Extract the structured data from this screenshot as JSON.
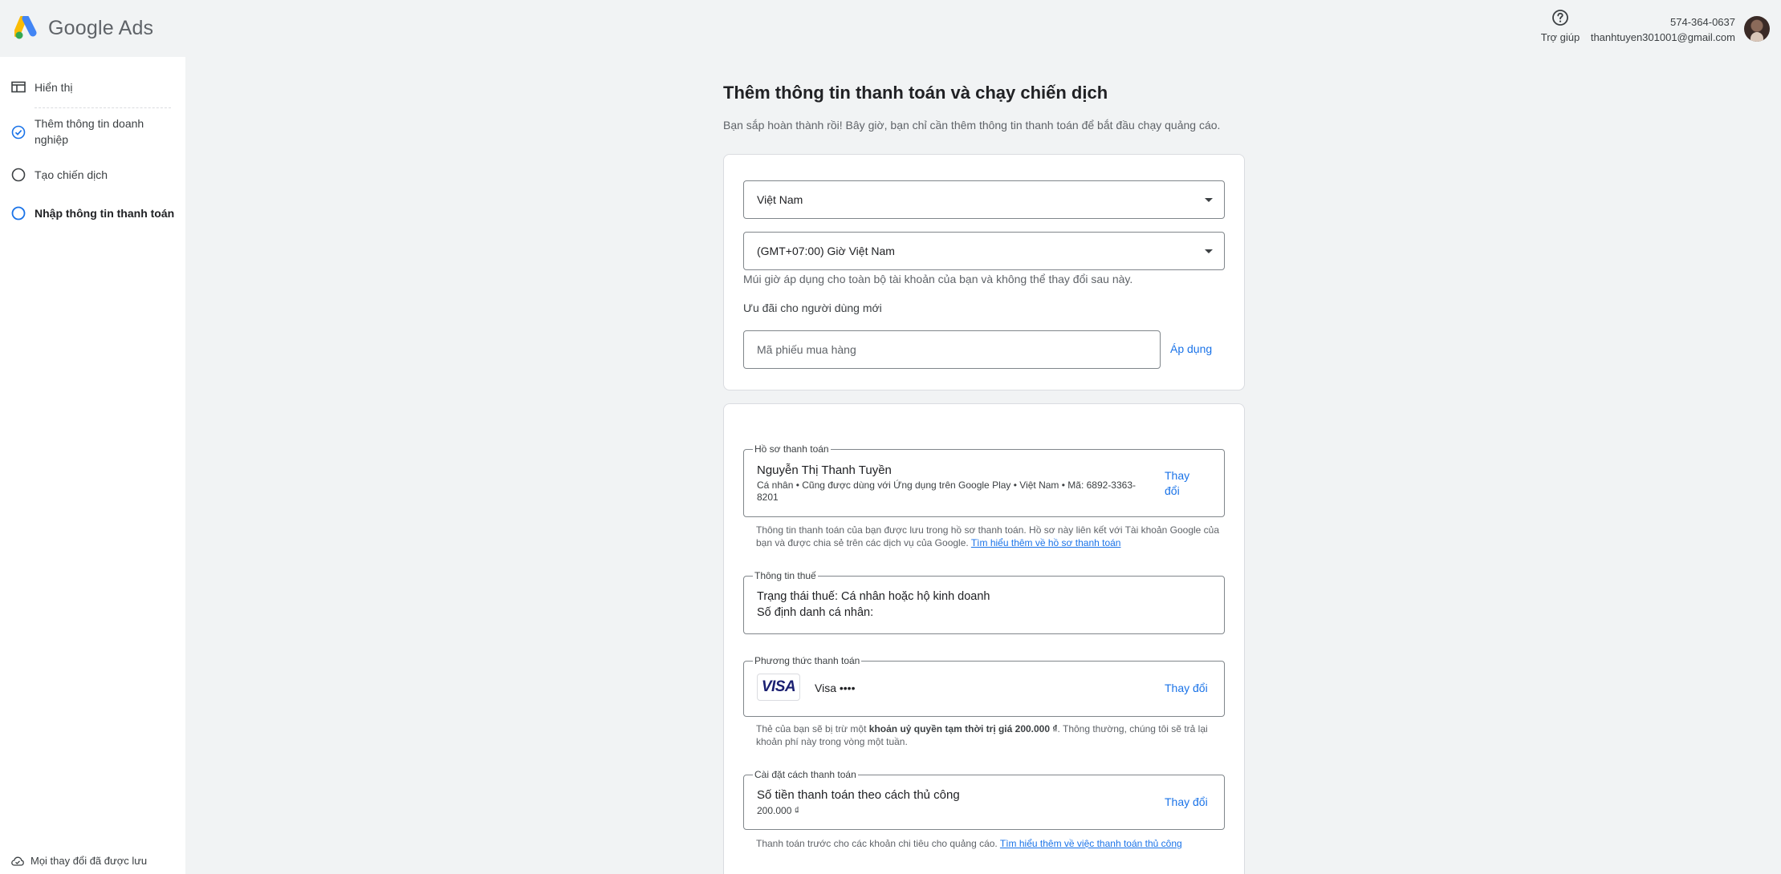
{
  "header": {
    "brand": "Google Ads",
    "help_label": "Trợ giúp",
    "account_phone": "574-364-0637",
    "account_email": "thanhtuyen301001@gmail.com"
  },
  "sidebar": {
    "items": [
      {
        "label": "Hiển thị",
        "icon": "display-icon",
        "state": "normal"
      },
      {
        "label": "Thêm thông tin doanh nghiệp",
        "icon": "check-circle-icon",
        "state": "done"
      },
      {
        "label": "Tạo chiến dịch",
        "icon": "empty-circle-icon",
        "state": "normal"
      },
      {
        "label": "Nhập thông tin thanh toán",
        "icon": "active-circle-icon",
        "state": "active"
      }
    ],
    "saved_status": "Mọi thay đổi đã được lưu"
  },
  "main": {
    "title": "Thêm thông tin thanh toán và chạy chiến dịch",
    "subtitle": "Bạn sắp hoàn thành rồi! Bây giờ, bạn chỉ cần thêm thông tin thanh toán để bắt đầu chạy quảng cáo.",
    "country_select": "Việt Nam",
    "timezone_select": "(GMT+07:00) Giờ Việt Nam",
    "timezone_hint": "Múi giờ áp dụng cho toàn bộ tài khoản của bạn và không thể thay đổi sau này.",
    "promo_label": "Ưu đãi cho người dùng mới",
    "promo_placeholder": "Mã phiếu mua hàng",
    "promo_apply": "Áp dụng",
    "payment_profile": {
      "legend": "Hồ sơ thanh toán",
      "name": "Nguyễn Thị Thanh Tuyền",
      "details": "Cá nhân • Cũng được dùng với Ứng dụng trên Google Play • Việt Nam • Mã: 6892-3363-8201",
      "change": "Thay đổi",
      "note": "Thông tin thanh toán của bạn được lưu trong hồ sơ thanh toán. Hồ sơ này liên kết với Tài khoản Google của bạn và được chia sẻ trên các dịch vụ của Google.",
      "note_link": "Tìm hiểu thêm về hồ sơ thanh toán"
    },
    "tax_info": {
      "legend": "Thông tin thuế",
      "status": "Trạng thái thuế: Cá nhân hoặc hộ kinh doanh",
      "id_label": "Số định danh cá nhân:"
    },
    "payment_method": {
      "legend": "Phương thức thanh toán",
      "card_logo": "VISA",
      "card_label": "Visa ••••",
      "change": "Thay đổi",
      "note_pre": "Thẻ của bạn sẽ bị trừ một ",
      "note_bold": "khoản uỷ quyền tạm thời trị giá 200.000 ₫",
      "note_post": ". Thông thường, chúng tôi sẽ trả lại khoản phí này trong vòng một tuần."
    },
    "payment_setting": {
      "legend": "Cài đặt cách thanh toán",
      "title": "Số tiền thanh toán theo cách thủ công",
      "amount": "200.000 ₫",
      "change": "Thay đổi",
      "note": "Thanh toán trước cho các khoản chi tiêu cho quảng cáo.",
      "note_link": "Tìm hiểu thêm về việc thanh toán thủ công"
    }
  }
}
